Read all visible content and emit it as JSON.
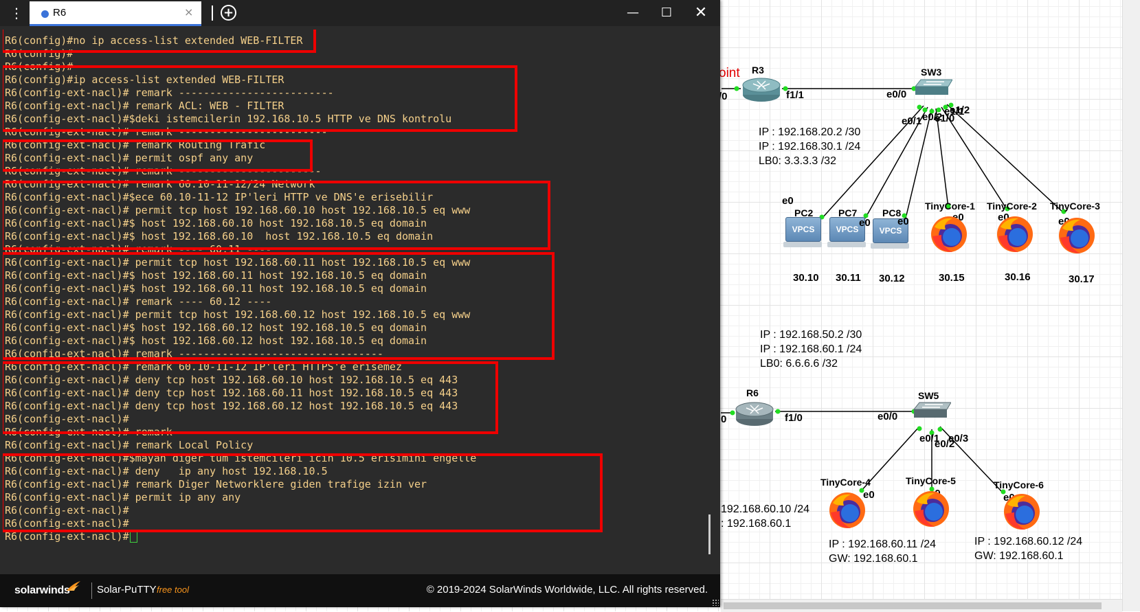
{
  "window": {
    "tab_label": "R6",
    "close_tab": "×",
    "add_tab": "+",
    "menu": "⋮",
    "minimize": "—",
    "maximize": "☐",
    "close": "✕"
  },
  "terminal": {
    "lines": [
      "R6(config)#no ip access-list extended WEB-FILTER",
      "R6(config)#",
      "R6(config)#",
      "R6(config)#ip access-list extended WEB-FILTER",
      "R6(config-ext-nacl)# remark -------------------------",
      "R6(config-ext-nacl)# remark ACL: WEB - FILTER",
      "R6(config-ext-nacl)#$deki istemcilerin 192.168.10.5 HTTP ve DNS kontrolu",
      "R6(config-ext-nacl)# remark ------------------------",
      "R6(config-ext-nacl)# remark Routing Trafic",
      "R6(config-ext-nacl)# permit ospf any any",
      "R6(config-ext-nacl)# remark -----------------------",
      "R6(config-ext-nacl)# remark 60.10-11-12/24 Network",
      "R6(config-ext-nacl)#$ece 60.10-11-12 IP'leri HTTP ve DNS'e erisebilir",
      "R6(config-ext-nacl)# permit tcp host 192.168.60.10 host 192.168.10.5 eq www",
      "R6(config-ext-nacl)#$ host 192.168.60.10 host 192.168.10.5 eq domain",
      "R6(config-ext-nacl)#$ host 192.168.60.10  host 192.168.10.5 eq domain",
      "R6(config-ext-nacl)# remark ---- 60.11 ----",
      "R6(config-ext-nacl)# permit tcp host 192.168.60.11 host 192.168.10.5 eq www",
      "R6(config-ext-nacl)#$ host 192.168.60.11 host 192.168.10.5 eq domain",
      "R6(config-ext-nacl)#$ host 192.168.60.11 host 192.168.10.5 eq domain",
      "R6(config-ext-nacl)# remark ---- 60.12 ----",
      "R6(config-ext-nacl)# permit tcp host 192.168.60.12 host 192.168.10.5 eq www",
      "R6(config-ext-nacl)#$ host 192.168.60.12 host 192.168.10.5 eq domain",
      "R6(config-ext-nacl)#$ host 192.168.60.12 host 192.168.10.5 eq domain",
      "R6(config-ext-nacl)# remark ---------------------------------",
      "R6(config-ext-nacl)# remark 60.10-11-12 IP'leri HTTPS'e erisemez",
      "R6(config-ext-nacl)# deny tcp host 192.168.60.10 host 192.168.10.5 eq 443",
      "R6(config-ext-nacl)# deny tcp host 192.168.60.11 host 192.168.10.5 eq 443",
      "R6(config-ext-nacl)# deny tcp host 192.168.60.12 host 192.168.10.5 eq 443",
      "R6(config-ext-nacl)#",
      "R6(config-ext-nacl)# remark -------------------------------",
      "R6(config-ext-nacl)# remark Local Policy",
      "R6(config-ext-nacl)#$mayan diger tum istemcileri icin 10.5 erisimini engelle",
      "R6(config-ext-nacl)# deny   ip any host 192.168.10.5",
      "R6(config-ext-nacl)# remark Diger Networklere giden trafige izin ver",
      "R6(config-ext-nacl)# permit ip any any",
      "R6(config-ext-nacl)#",
      "R6(config-ext-nacl)#",
      "R6(config-ext-nacl)#"
    ]
  },
  "footer": {
    "logo": "solarwinds",
    "product": "Solar-PuTTY",
    "free_tag": "free tool",
    "copyright": "© 2019-2024 SolarWinds Worldwide, LLC. All rights reserved."
  },
  "topology": {
    "cut_red_label": "oint",
    "r3": {
      "name": "R3",
      "left_if": "/0",
      "right_if": "f1/1"
    },
    "sw3": {
      "name": "SW3",
      "if_left": "e0/0",
      "if_e01": "e0/1",
      "if_stack": "e0/2",
      "if_stack2": "e1/0",
      "if_e11": "e1/1",
      "if_e12": "e1/2"
    },
    "r3_note": [
      "IP : 192.168.20.2 /30",
      "IP : 192.168.30.1 /24",
      "LB0: 3.3.3.3 /32"
    ],
    "hosts_top": [
      {
        "name": "PC2",
        "ip": "30.10",
        "if": "e0",
        "badge": "VPCS"
      },
      {
        "name": "PC7",
        "ip": "30.11",
        "if": "e0",
        "badge": "VPCS"
      },
      {
        "name": "PC8",
        "ip": "30.12",
        "if": "e0",
        "badge": "VPCS"
      },
      {
        "name": "TinyCore-1",
        "ip": "30.15",
        "if": "e0"
      },
      {
        "name": "TinyCore-2",
        "ip": "30.16",
        "if": "e0"
      },
      {
        "name": "TinyCore-3",
        "ip": "30.17",
        "if": "e0"
      }
    ],
    "r6_note": [
      "IP : 192.168.50.2 /30",
      "IP : 192.168.60.1 /24",
      "LB0: 6.6.6.6 /32"
    ],
    "r6": {
      "name": "R6",
      "left_if": "0",
      "right_if": "f1/0"
    },
    "sw5": {
      "name": "SW5",
      "if_left": "e0/0",
      "if_e01": "e0/1",
      "if_e02": "e0/2",
      "if_e03": "e0/3"
    },
    "hosts_bottom": [
      {
        "name": "TinyCore-4",
        "if": "e0"
      },
      {
        "name": "TinyCore-5",
        "if": "e0"
      },
      {
        "name": "TinyCore-6",
        "if": "e0"
      }
    ],
    "tc4_note": [
      "192.168.60.10 /24",
      ": 192.168.60.1"
    ],
    "tc5_note": [
      "IP : 192.168.60.11 /24",
      "GW: 192.168.60.1"
    ],
    "tc6_note": [
      "IP : 192.168.60.12 /24",
      "GW: 192.168.60.1"
    ]
  }
}
